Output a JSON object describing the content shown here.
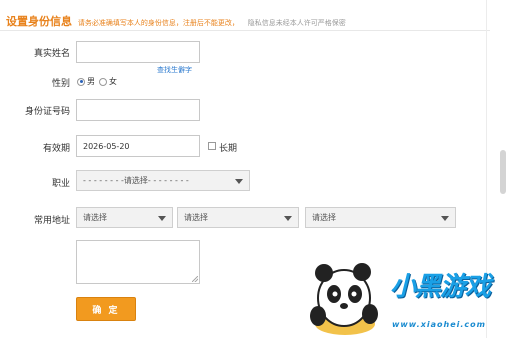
{
  "header": {
    "title": "设置身份信息",
    "notice": "请务必准确填写本人的身份信息，注册后不能更改，",
    "notice_tail": "隐私信息未经本人许可严格保密"
  },
  "form": {
    "name": {
      "label": "真实姓名",
      "value": "",
      "link": "查找生僻字"
    },
    "gender": {
      "label": "性别",
      "male": "男",
      "female": "女",
      "selected": "男"
    },
    "id_number": {
      "label": "身份证号码",
      "value": ""
    },
    "expiry": {
      "label": "有效期",
      "value": "2026-05-20",
      "long_term": "长期",
      "long_term_checked": false
    },
    "occupation": {
      "label": "职业",
      "value": "- - - - - - - -请选择- - - - - - - -"
    },
    "address": {
      "label": "常用地址",
      "province": "请选择",
      "city": "请选择",
      "district": "请选择",
      "detail": ""
    },
    "submit_label": "确 定"
  },
  "watermark": {
    "brand": "小黑游戏",
    "url": "www.xiaohei.com"
  },
  "colors": {
    "accent": "#e8821c",
    "button": "#f29a1f",
    "link": "#2e7bcf",
    "logo": "#1aa0e6"
  }
}
